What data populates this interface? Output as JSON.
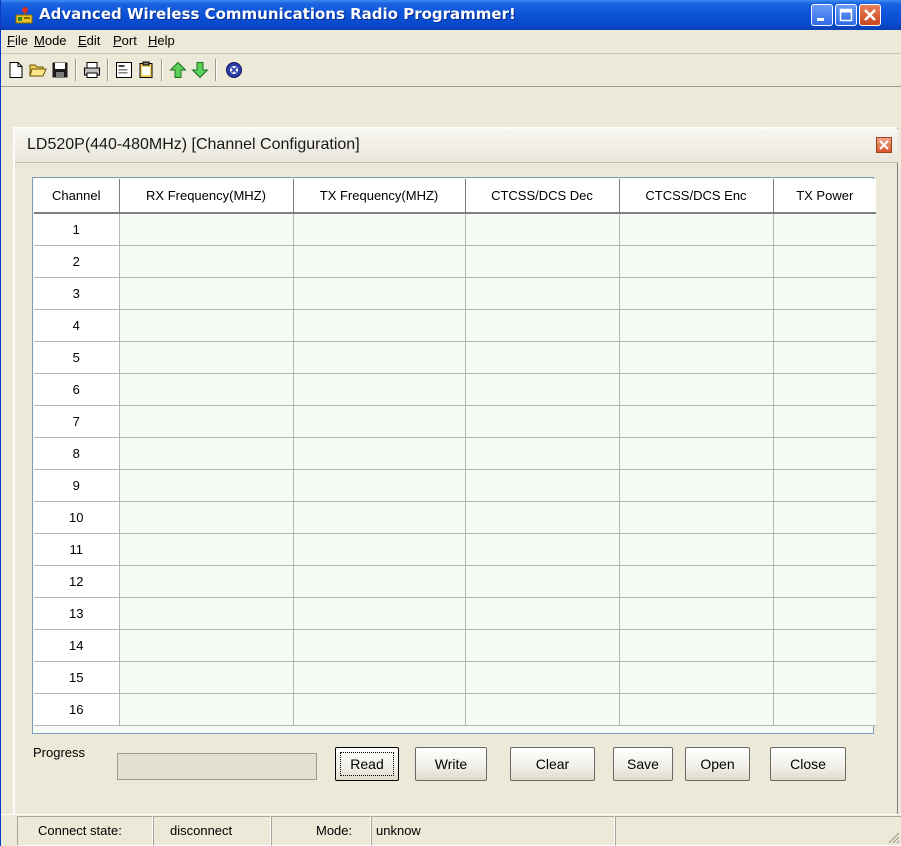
{
  "window": {
    "title": "Advanced Wireless Communications Radio Programmer!"
  },
  "menu": [
    {
      "label": "File",
      "underline": "F",
      "rest": "ile"
    },
    {
      "label": "Mode",
      "underline": "M",
      "rest": "ode"
    },
    {
      "label": "Edit",
      "underline": "E",
      "rest": "dit"
    },
    {
      "label": "Port",
      "underline": "P",
      "rest": "ort"
    },
    {
      "label": "Help",
      "underline": "H",
      "rest": "elp"
    }
  ],
  "toolbar": {
    "icons": [
      "new-file-icon",
      "open-folder-icon",
      "save-disk-icon",
      "print-icon",
      "properties-icon",
      "clipboard-icon",
      "upload-arrow-icon",
      "download-arrow-icon",
      "about-icon"
    ]
  },
  "child_window": {
    "title": "LD520P(440-480MHz) [Channel  Configuration]"
  },
  "grid": {
    "columns": [
      "Channel",
      "RX Frequency(MHZ)",
      "TX Frequency(MHZ)",
      "CTCSS/DCS Dec",
      "CTCSS/DCS Enc",
      "TX Power"
    ],
    "rows": [
      {
        "channel": "1",
        "rx": "",
        "tx": "",
        "dec": "",
        "enc": "",
        "power": ""
      },
      {
        "channel": "2",
        "rx": "",
        "tx": "",
        "dec": "",
        "enc": "",
        "power": ""
      },
      {
        "channel": "3",
        "rx": "",
        "tx": "",
        "dec": "",
        "enc": "",
        "power": ""
      },
      {
        "channel": "4",
        "rx": "",
        "tx": "",
        "dec": "",
        "enc": "",
        "power": ""
      },
      {
        "channel": "5",
        "rx": "",
        "tx": "",
        "dec": "",
        "enc": "",
        "power": ""
      },
      {
        "channel": "6",
        "rx": "",
        "tx": "",
        "dec": "",
        "enc": "",
        "power": ""
      },
      {
        "channel": "7",
        "rx": "",
        "tx": "",
        "dec": "",
        "enc": "",
        "power": ""
      },
      {
        "channel": "8",
        "rx": "",
        "tx": "",
        "dec": "",
        "enc": "",
        "power": ""
      },
      {
        "channel": "9",
        "rx": "",
        "tx": "",
        "dec": "",
        "enc": "",
        "power": ""
      },
      {
        "channel": "10",
        "rx": "",
        "tx": "",
        "dec": "",
        "enc": "",
        "power": ""
      },
      {
        "channel": "11",
        "rx": "",
        "tx": "",
        "dec": "",
        "enc": "",
        "power": ""
      },
      {
        "channel": "12",
        "rx": "",
        "tx": "",
        "dec": "",
        "enc": "",
        "power": ""
      },
      {
        "channel": "13",
        "rx": "",
        "tx": "",
        "dec": "",
        "enc": "",
        "power": ""
      },
      {
        "channel": "14",
        "rx": "",
        "tx": "",
        "dec": "",
        "enc": "",
        "power": ""
      },
      {
        "channel": "15",
        "rx": "",
        "tx": "",
        "dec": "",
        "enc": "",
        "power": ""
      },
      {
        "channel": "16",
        "rx": "",
        "tx": "",
        "dec": "",
        "enc": "",
        "power": ""
      }
    ]
  },
  "controls": {
    "progress_label": "Progress",
    "progress_value": 0,
    "read_label": "Read",
    "write_label": "Write",
    "clear_label": "Clear",
    "save_label": "Save",
    "open_label": "Open",
    "close_label": "Close"
  },
  "status": {
    "connect_label": "Connect state:",
    "connect_value": "disconnect",
    "mode_label": "Mode:",
    "mode_value": "unknow"
  },
  "colors": {
    "title_bar": "#0a52d7",
    "grid_cell": "#f5fcf5",
    "window_bg": "#ece9d8"
  }
}
